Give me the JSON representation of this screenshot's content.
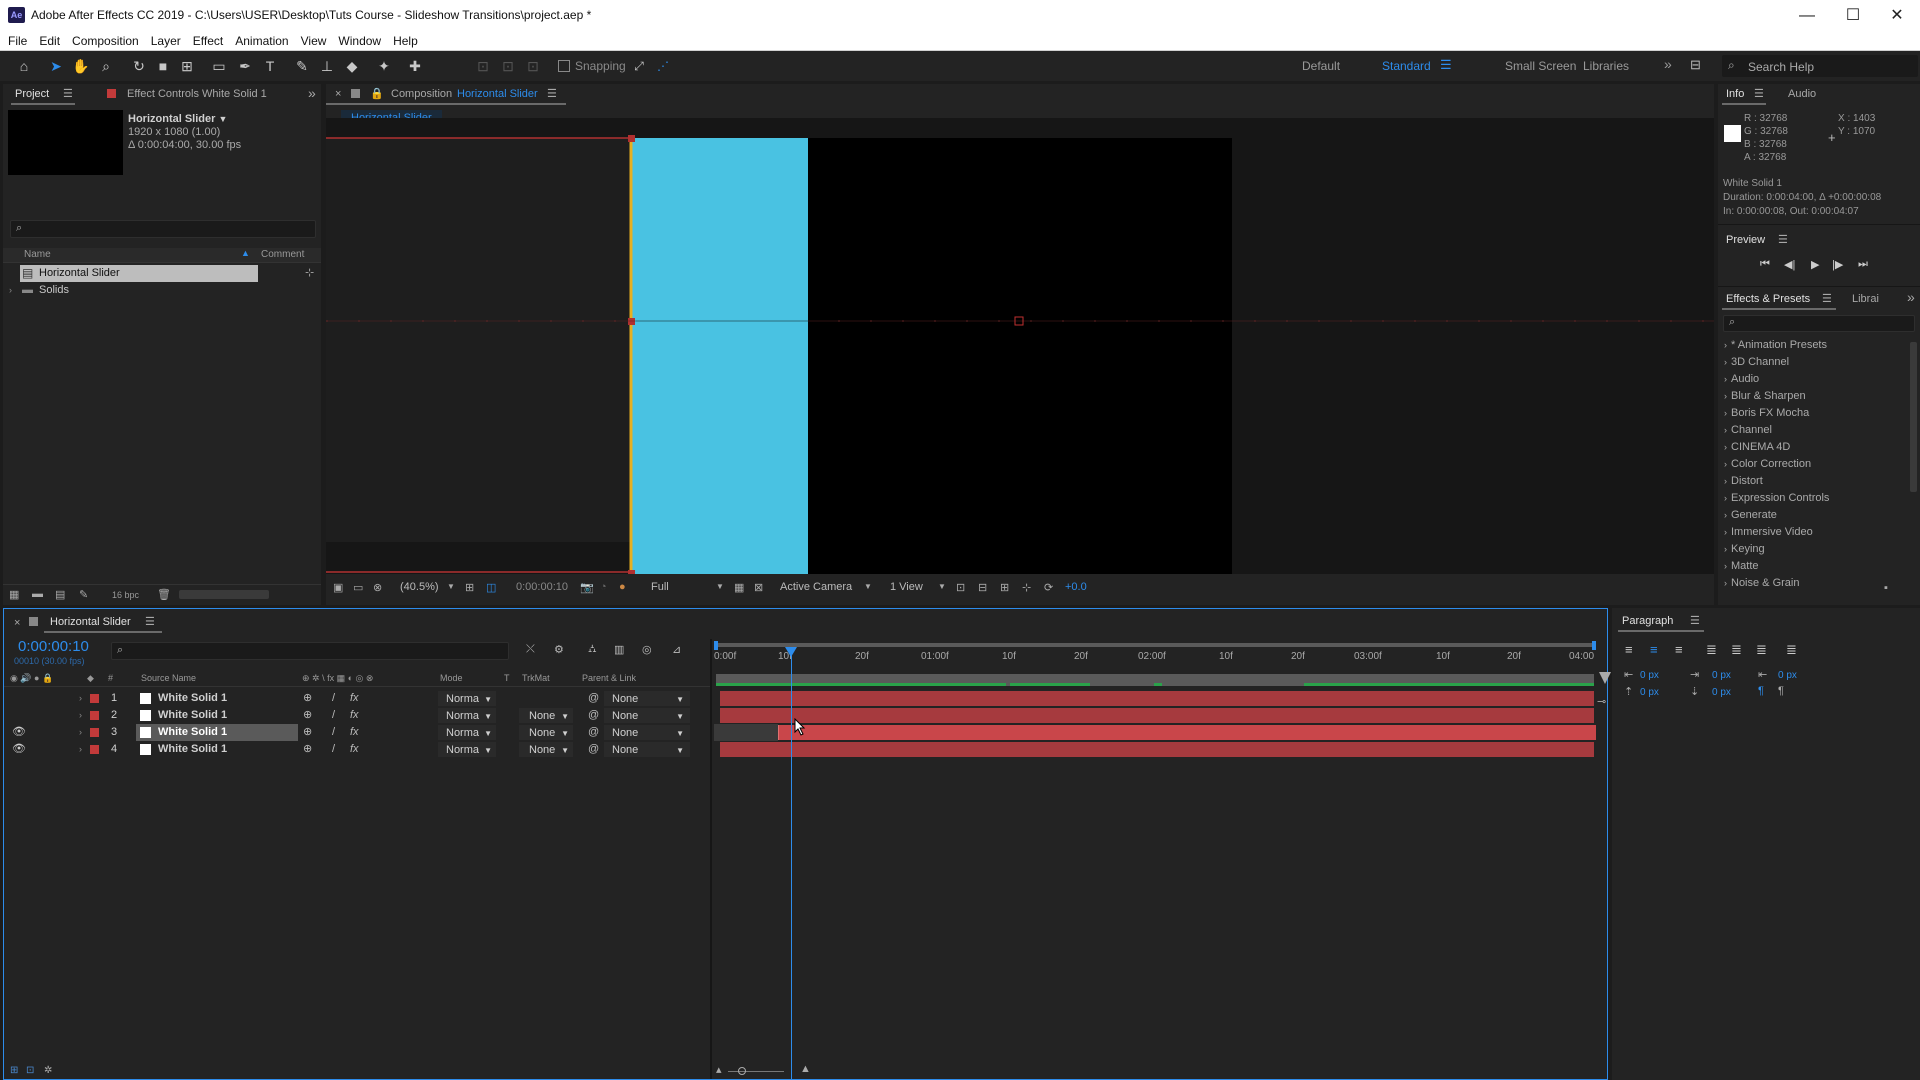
{
  "titlebar": {
    "title": "Adobe After Effects CC 2019 - C:\\Users\\USER\\Desktop\\Tuts Course - Slideshow Transitions\\project.aep *",
    "app_icon": "Ae",
    "minimize": "—",
    "maximize": "☐",
    "close": "✕"
  },
  "menu": [
    "File",
    "Edit",
    "Composition",
    "Layer",
    "Effect",
    "Animation",
    "View",
    "Window",
    "Help"
  ],
  "toolbar": {
    "snapping_label": "Snapping",
    "workspaces": [
      "Default",
      "Standard",
      "Small Screen",
      "Libraries"
    ],
    "active_workspace": "Standard",
    "search_placeholder": "Search Help"
  },
  "project": {
    "tab_project": "Project",
    "tab_effect_controls": "Effect Controls White Solid 1",
    "comp_name": "Horizontal Slider",
    "comp_size": "1920 x 1080 (1.00)",
    "comp_duration": "Δ 0:00:04:00, 30.00 fps",
    "col_name": "Name",
    "col_comment": "Comment",
    "items": [
      {
        "name": "Horizontal Slider",
        "type": "comp"
      },
      {
        "name": "Solids",
        "type": "folder"
      }
    ],
    "bpc": "16 bpc"
  },
  "composition": {
    "tab_prefix": "Composition",
    "tab_name": "Horizontal Slider",
    "breadcrumb": "Horizontal Slider",
    "zoom": "(40.5%)",
    "timecode": "0:00:00:10",
    "resolution": "Full",
    "camera": "Active Camera",
    "views": "1 View",
    "exposure": "+0.0",
    "colors": {
      "solid": "#49c2e2",
      "background": "#000000"
    }
  },
  "info": {
    "tab_info": "Info",
    "tab_audio": "Audio",
    "r": "R : 32768",
    "g": "G : 32768",
    "b": "B : 32768",
    "a": "A : 32768",
    "x": "X : 1403",
    "y": "Y : 1070",
    "layer": "White Solid 1",
    "duration": "Duration: 0:00:04:00, Δ +0:00:00:08",
    "inout": "In: 0:00:00:08, Out: 0:00:04:07"
  },
  "preview": {
    "title": "Preview"
  },
  "effects": {
    "tab": "Effects & Presets",
    "tab2": "Librai",
    "items": [
      "* Animation Presets",
      "3D Channel",
      "Audio",
      "Blur & Sharpen",
      "Boris FX Mocha",
      "Channel",
      "CINEMA 4D",
      "Color Correction",
      "Distort",
      "Expression Controls",
      "Generate",
      "Immersive Video",
      "Keying",
      "Matte",
      "Noise & Grain"
    ]
  },
  "timeline": {
    "tab": "Horizontal Slider",
    "timecode": "0:00:00:10",
    "frames": "00010 (30.00 fps)",
    "headers": {
      "num": "#",
      "source": "Source Name",
      "mode": "Mode",
      "t": "T",
      "trkmat": "TrkMat",
      "parent": "Parent & Link"
    },
    "ruler": [
      "0:00f",
      "10f",
      "20f",
      "01:00f",
      "10f",
      "20f",
      "02:00f",
      "10f",
      "20f",
      "03:00f",
      "10f",
      "20f",
      "04:00"
    ],
    "layers": [
      {
        "num": "1",
        "name": "White Solid 1",
        "mode": "Norma",
        "trkmat": "",
        "parent": "None",
        "visible": false,
        "selected": false
      },
      {
        "num": "2",
        "name": "White Solid 1",
        "mode": "Norma",
        "trkmat": "None",
        "parent": "None",
        "visible": false,
        "selected": false
      },
      {
        "num": "3",
        "name": "White Solid 1",
        "mode": "Norma",
        "trkmat": "None",
        "parent": "None",
        "visible": true,
        "selected": true
      },
      {
        "num": "4",
        "name": "White Solid 1",
        "mode": "Norma",
        "trkmat": "None",
        "parent": "None",
        "visible": true,
        "selected": false
      }
    ]
  },
  "paragraph": {
    "title": "Paragraph",
    "indent_left": "0 px",
    "indent_right": "0 px",
    "indent_first": "0 px",
    "space_before": "0 px",
    "space_after": "0 px"
  }
}
